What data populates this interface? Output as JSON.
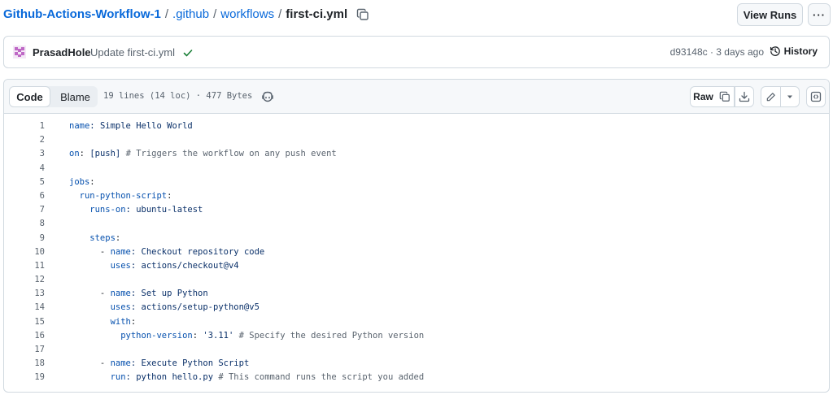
{
  "breadcrumb": {
    "repo": "Github-Actions-Workflow-1",
    "sep": "/",
    "dir1": ".github",
    "dir2": "workflows",
    "file": "first-ci.yml"
  },
  "actions": {
    "view_runs": "View Runs",
    "more": "···"
  },
  "commit": {
    "author": "PrasadHole",
    "message": "Update first-ci.yml",
    "meta": "d93148c · 3 days ago",
    "history": "History"
  },
  "file": {
    "tab_code": "Code",
    "tab_blame": "Blame",
    "info": "19 lines (14 loc) · 477 Bytes",
    "raw": "Raw"
  },
  "code": [
    {
      "n": "1",
      "parts": [
        {
          "t": "name",
          "c": "k"
        },
        {
          "t": ": Simple Hello World",
          "c": "s"
        }
      ]
    },
    {
      "n": "2",
      "parts": []
    },
    {
      "n": "3",
      "parts": [
        {
          "t": "on",
          "c": "k"
        },
        {
          "t": ": ",
          "c": ""
        },
        {
          "t": "[push]",
          "c": "s"
        },
        {
          "t": " # Triggers the workflow on any push event",
          "c": "c"
        }
      ]
    },
    {
      "n": "4",
      "parts": []
    },
    {
      "n": "5",
      "parts": [
        {
          "t": "jobs",
          "c": "k"
        },
        {
          "t": ":",
          "c": ""
        }
      ]
    },
    {
      "n": "6",
      "parts": [
        {
          "t": "  run-python-script",
          "c": "k"
        },
        {
          "t": ":",
          "c": ""
        }
      ]
    },
    {
      "n": "7",
      "parts": [
        {
          "t": "    runs-on",
          "c": "k"
        },
        {
          "t": ": ubuntu-latest",
          "c": "s"
        }
      ]
    },
    {
      "n": "8",
      "parts": []
    },
    {
      "n": "9",
      "parts": [
        {
          "t": "    steps",
          "c": "k"
        },
        {
          "t": ":",
          "c": ""
        }
      ]
    },
    {
      "n": "10",
      "parts": [
        {
          "t": "      - ",
          "c": ""
        },
        {
          "t": "name",
          "c": "k"
        },
        {
          "t": ": Checkout repository code",
          "c": "s"
        }
      ]
    },
    {
      "n": "11",
      "parts": [
        {
          "t": "        uses",
          "c": "k"
        },
        {
          "t": ": actions/checkout@v4",
          "c": "s"
        }
      ]
    },
    {
      "n": "12",
      "parts": []
    },
    {
      "n": "13",
      "parts": [
        {
          "t": "      - ",
          "c": ""
        },
        {
          "t": "name",
          "c": "k"
        },
        {
          "t": ": Set up Python",
          "c": "s"
        }
      ]
    },
    {
      "n": "14",
      "parts": [
        {
          "t": "        uses",
          "c": "k"
        },
        {
          "t": ": actions/setup-python@v5",
          "c": "s"
        }
      ]
    },
    {
      "n": "15",
      "parts": [
        {
          "t": "        with",
          "c": "k"
        },
        {
          "t": ":",
          "c": ""
        }
      ]
    },
    {
      "n": "16",
      "parts": [
        {
          "t": "          python-version",
          "c": "k"
        },
        {
          "t": ": ",
          "c": ""
        },
        {
          "t": "'3.11'",
          "c": "s"
        },
        {
          "t": " # Specify the desired Python version",
          "c": "c"
        }
      ]
    },
    {
      "n": "17",
      "parts": []
    },
    {
      "n": "18",
      "parts": [
        {
          "t": "      - ",
          "c": ""
        },
        {
          "t": "name",
          "c": "k"
        },
        {
          "t": ": Execute Python Script",
          "c": "s"
        }
      ]
    },
    {
      "n": "19",
      "parts": [
        {
          "t": "        run",
          "c": "k"
        },
        {
          "t": ": python hello.py",
          "c": "s"
        },
        {
          "t": " # This command runs the script you added",
          "c": "c"
        }
      ]
    }
  ],
  "colors": {
    "link": "#0969da",
    "check": "#1a7f37",
    "avatar": "#bf69c6"
  }
}
